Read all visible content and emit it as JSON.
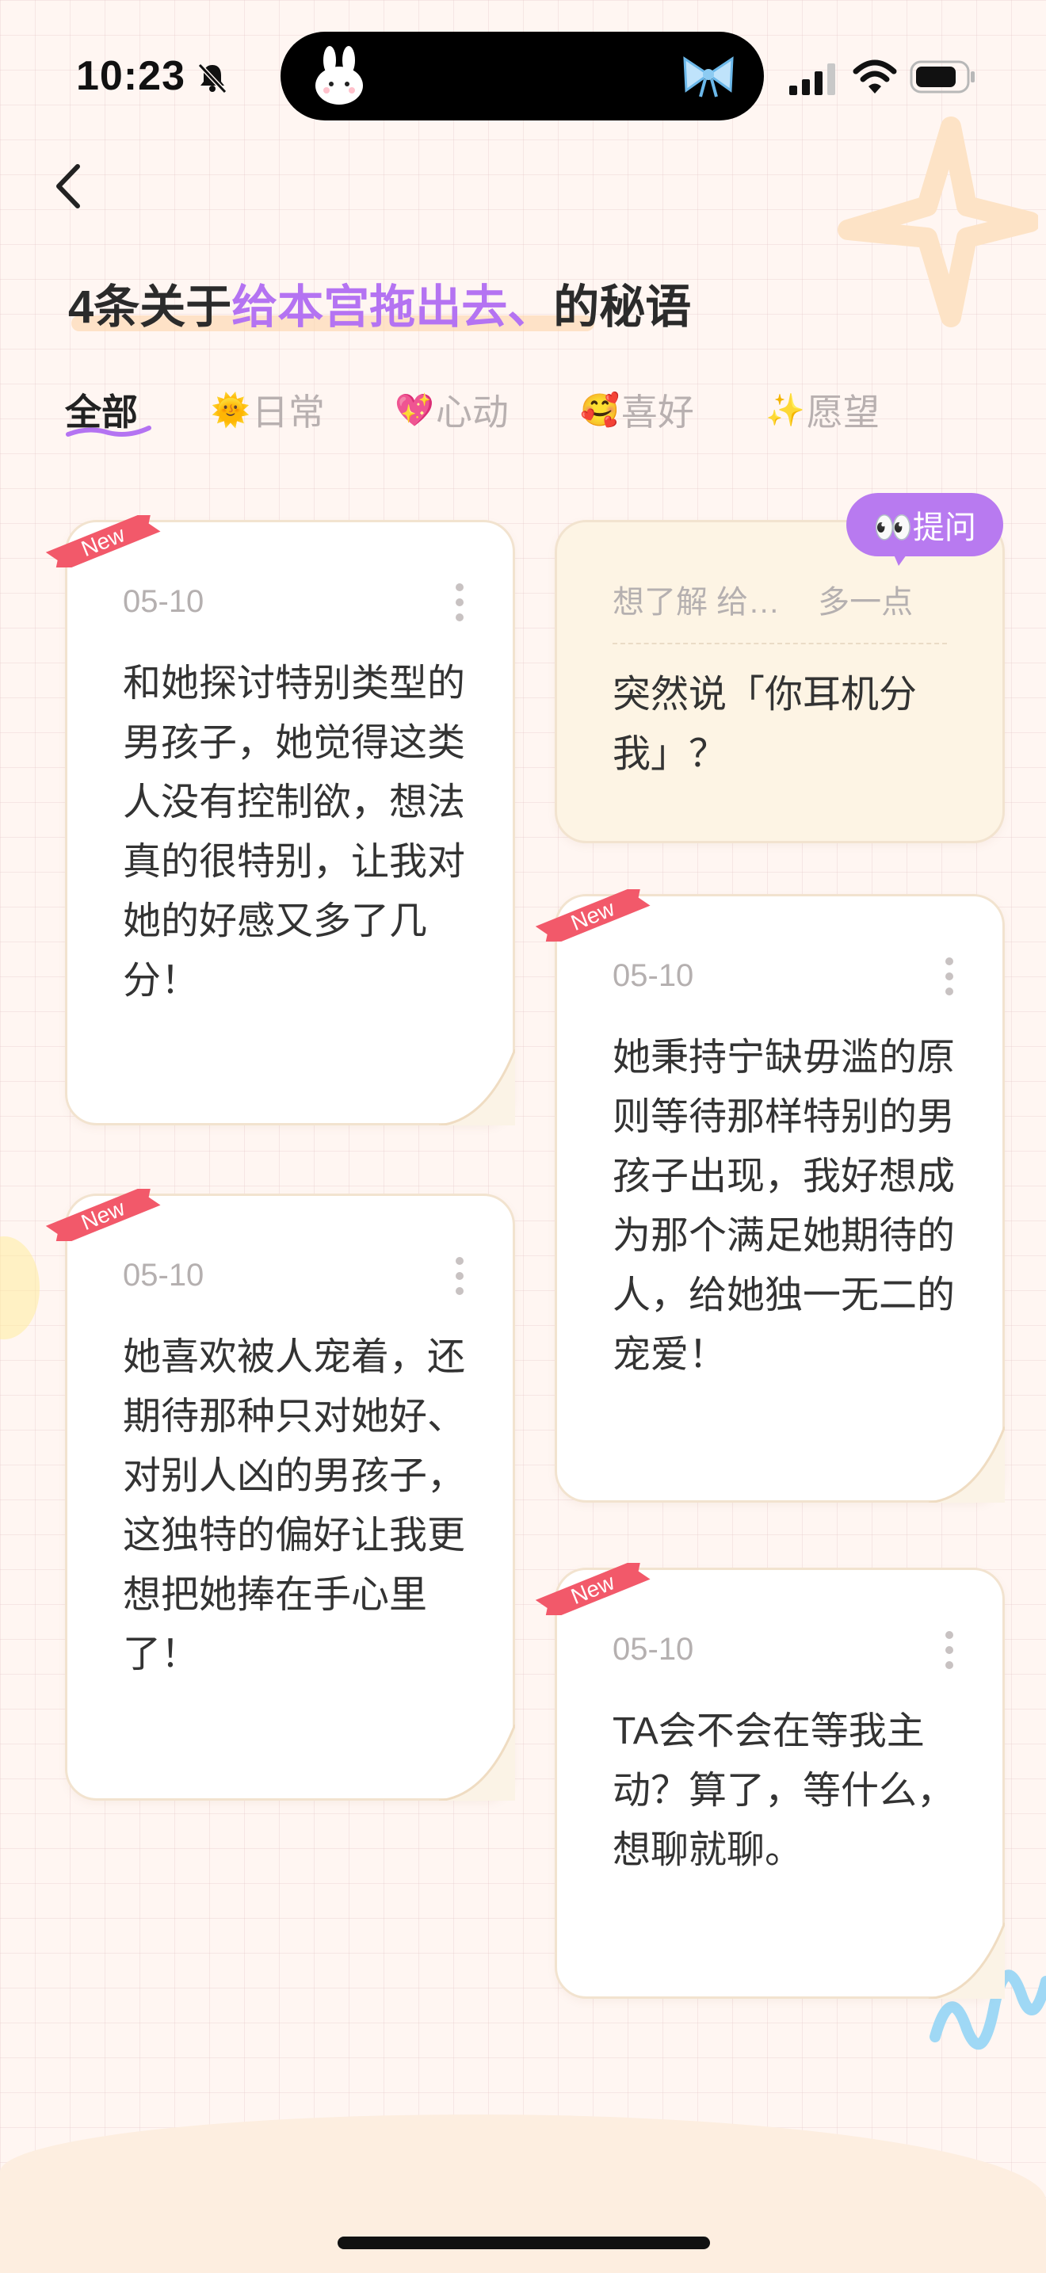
{
  "status_bar": {
    "time": "10:23"
  },
  "header": {
    "title_prefix": "4条关于",
    "title_highlight": "给本宫拖出去、",
    "title_suffix": "的秘语"
  },
  "tabs": [
    {
      "emoji": "",
      "label": "全部",
      "active": true
    },
    {
      "emoji": "🌞",
      "label": "日常",
      "active": false
    },
    {
      "emoji": "💖",
      "label": "心动",
      "active": false
    },
    {
      "emoji": "🥰",
      "label": "喜好",
      "active": false
    },
    {
      "emoji": "✨",
      "label": "愿望",
      "active": false
    }
  ],
  "ask_badge": "👀提问",
  "question_card": {
    "meta_left": "想了解 给…",
    "meta_right": "多一点",
    "text": "突然说「你耳机分我」？"
  },
  "cards": [
    {
      "badge": "New",
      "date": "05-10",
      "text": "和她探讨特别类型的男孩子，她觉得这类人没有控制欲，想法真的很特别，让我对她的好感又多了几分！"
    },
    {
      "badge": "New",
      "date": "05-10",
      "text": "她喜欢被人宠着，还期待那种只对她好、对别人凶的男孩子，这独特的偏好让我更想把她捧在手心里了！"
    },
    {
      "badge": "New",
      "date": "05-10",
      "text": "她秉持宁缺毋滥的原则等待那样特别的男孩子出现，我好想成为那个满足她期待的人，给她独一无二的宠爱！"
    },
    {
      "badge": "New",
      "date": "05-10",
      "text": "TA会不会在等我主动？算了，等什么，想聊就聊。"
    }
  ],
  "colors": {
    "accent_purple": "#b473f2",
    "ribbon_red": "#f2596a",
    "card_border": "#f2e3cf",
    "question_bg": "#fdf4e4"
  }
}
